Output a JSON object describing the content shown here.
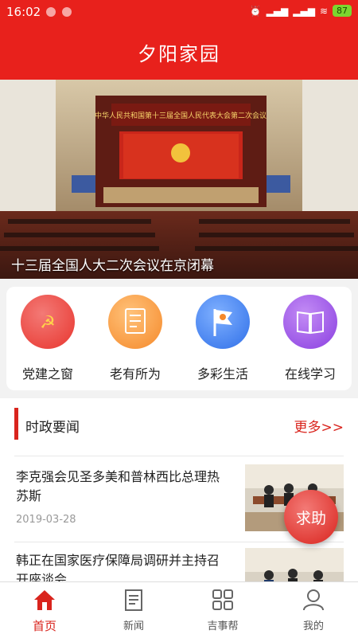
{
  "status_bar": {
    "time": "16:02",
    "battery": "87"
  },
  "app": {
    "title": "夕阳家园"
  },
  "banner": {
    "caption": "十三届全国人大二次会议在京闭幕",
    "screen_text": "中华人民共和国第十三届全国人民代表大会第二次会议"
  },
  "quick_nav": [
    {
      "label": "党建之窗",
      "icon": "party-emblem-icon",
      "color": "#e8352e"
    },
    {
      "label": "老有所为",
      "icon": "document-icon",
      "color": "#f5892a"
    },
    {
      "label": "多彩生活",
      "icon": "flag-icon",
      "color": "#2f6fe8"
    },
    {
      "label": "在线学习",
      "icon": "book-icon",
      "color": "#8a3fe0"
    }
  ],
  "news_section": {
    "title": "时政要闻",
    "more": "更多>>",
    "items": [
      {
        "title": "李克强会见圣多美和普林西比总理热苏斯",
        "date": "2019-03-28"
      },
      {
        "title": "韩正在国家医疗保障局调研并主持召开座谈会",
        "date": ""
      }
    ]
  },
  "help_button": {
    "label": "求助"
  },
  "tabs": [
    {
      "label": "首页",
      "icon": "home-icon",
      "active": true
    },
    {
      "label": "新闻",
      "icon": "news-icon",
      "active": false
    },
    {
      "label": "吉事帮",
      "icon": "grid-icon",
      "active": false
    },
    {
      "label": "我的",
      "icon": "user-icon",
      "active": false
    }
  ],
  "colors": {
    "brand_red": "#e8211c",
    "accent": "#d9241d"
  }
}
